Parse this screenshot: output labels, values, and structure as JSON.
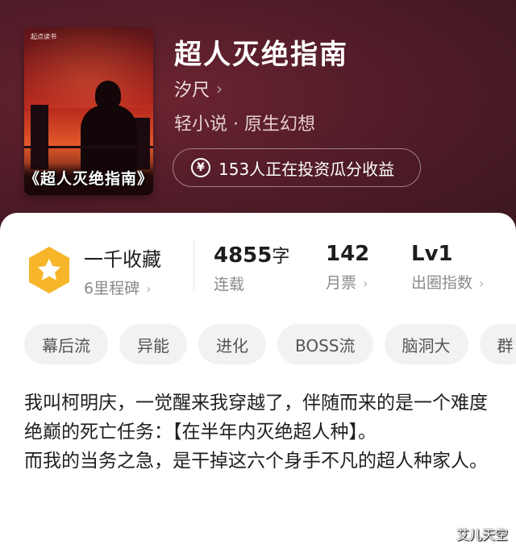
{
  "header": {
    "cover": {
      "publisher": "起点读书",
      "title_art": "《超人灭绝指南》"
    },
    "title": "超人灭绝指南",
    "author": "汐尺",
    "category": "轻小说 · 原生幻想",
    "invest_label": "153人正在投资瓜分收益",
    "colors": {
      "background": "#4e1b27",
      "accent": "#f5a623"
    }
  },
  "stats": {
    "favorites": {
      "value": "一千收藏",
      "sub": "6里程碑",
      "icon": "star-badge-icon"
    },
    "words": {
      "value": "4855",
      "unit": "字",
      "sub": "连载"
    },
    "monthly_tickets": {
      "value": "142",
      "sub": "月票"
    },
    "breakout_index": {
      "value": "Lv1",
      "sub": "出圈指数"
    }
  },
  "tags": [
    "幕后流",
    "异能",
    "进化",
    "BOSS流",
    "脑洞大",
    "群"
  ],
  "synopsis": {
    "paragraph1": "我叫柯明庆，一觉醒来我穿越了，伴随而来的是一个难度绝巅的死亡任务：【在半年内灭绝超人种】。",
    "paragraph2": "而我的当务之急，是干掉这六个身手不凡的超人种家人。"
  },
  "watermark": "艾儿天空"
}
